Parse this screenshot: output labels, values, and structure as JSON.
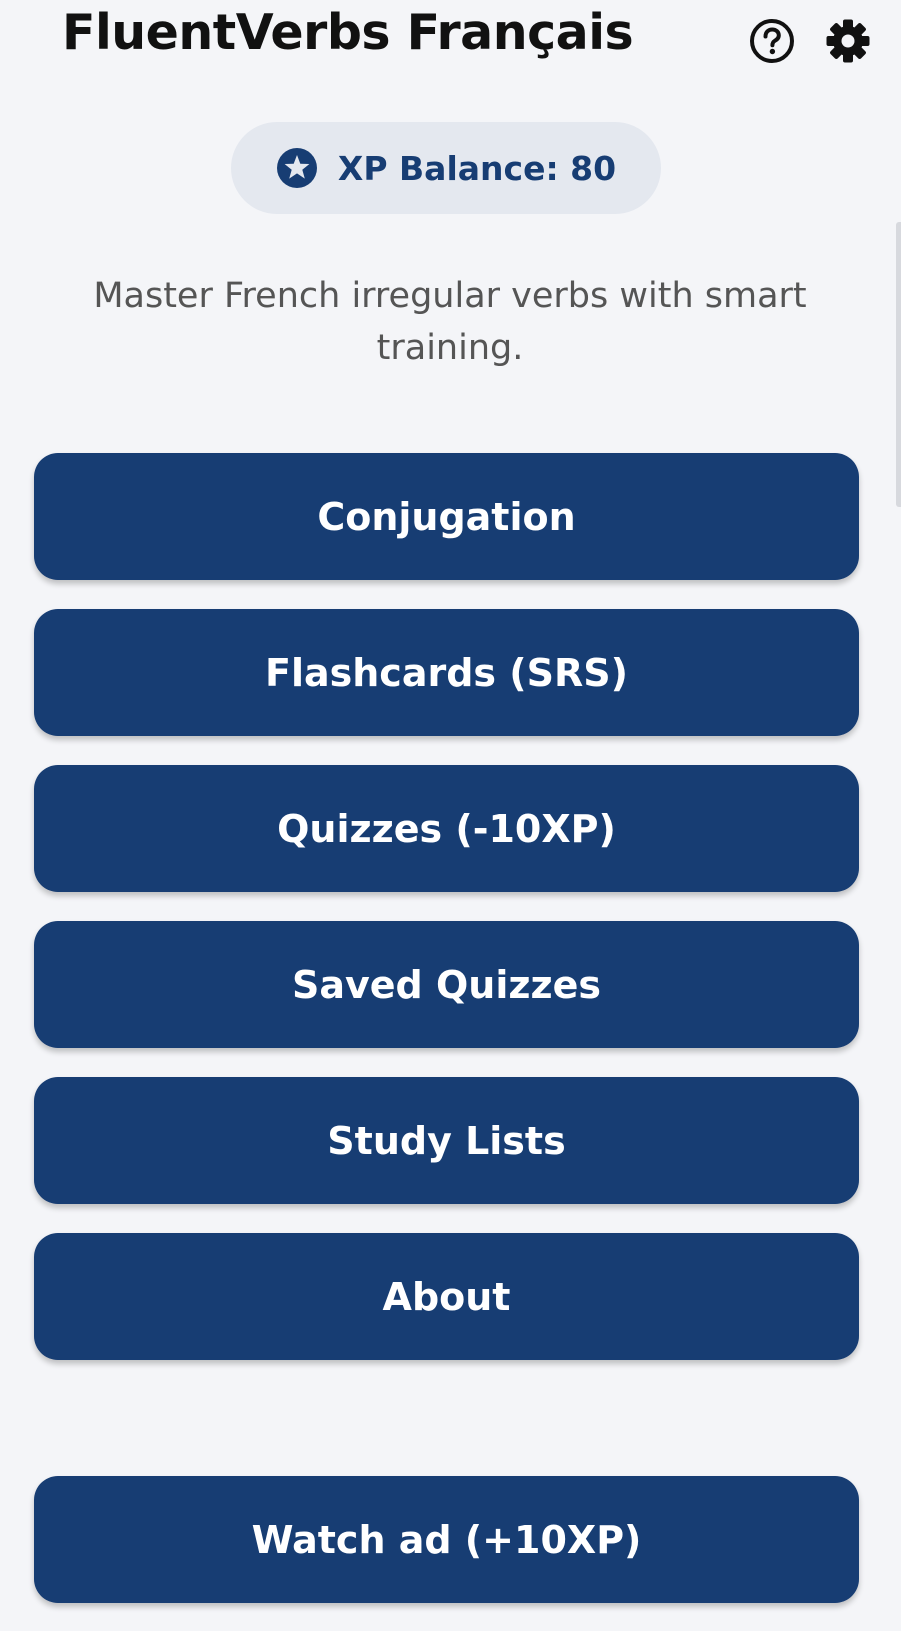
{
  "header": {
    "title": "FluentVerbs Français",
    "help_icon": "help-circle-icon",
    "settings_icon": "gear-icon"
  },
  "xp": {
    "icon": "star-circle-icon",
    "label": "XP Balance: 80"
  },
  "tagline": "Master French irregular verbs with smart training.",
  "menu": {
    "conjugation": "Conjugation",
    "flashcards": "Flashcards (SRS)",
    "quizzes": "Quizzes (-10XP)",
    "saved_quizzes": "Saved Quizzes",
    "study_lists": "Study Lists",
    "about": "About"
  },
  "watch_ad": "Watch ad (+10XP)",
  "colors": {
    "primary": "#173d73",
    "background": "#f4f5f8",
    "pill": "#e4e8ef",
    "title": "#111111",
    "tagline": "#555555"
  }
}
